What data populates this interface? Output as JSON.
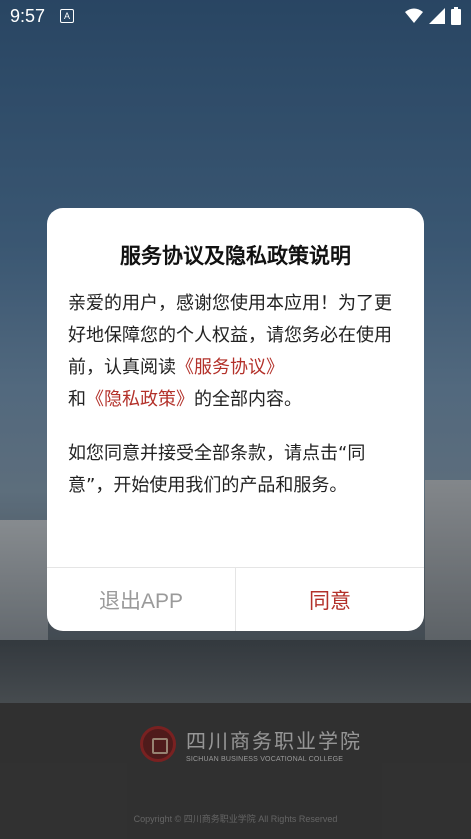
{
  "status_bar": {
    "time": "9:57",
    "notification_icon": "a-icon",
    "wifi_icon": "wifi-icon",
    "signal_icon": "signal-icon",
    "battery_icon": "battery-icon"
  },
  "dialog": {
    "title": "服务协议及隐私政策说明",
    "paragraph1": {
      "text_before": "亲爱的用户，感谢您使用本应用！为了更好地保障您的个人权益，请您务必在使用前，认真阅读",
      "link_service": "《服务协议》",
      "text_and": "和",
      "link_privacy": "《隐私政策》",
      "text_after": "的全部内容。"
    },
    "paragraph2": "如您同意并接受全部条款，请点击“同意”，开始使用我们的产品和服务。",
    "exit_label": "退出APP",
    "agree_label": "同意"
  },
  "footer": {
    "logo_cn": "四川商务职业学院",
    "logo_en": "SICHUAN BUSINESS VOCATIONAL COLLEGE",
    "copyright": "Copyright © 四川商务职业学院 All Rights Reserved"
  },
  "colors": {
    "accent": "#b3312a",
    "disabled": "#9a9a9a"
  }
}
